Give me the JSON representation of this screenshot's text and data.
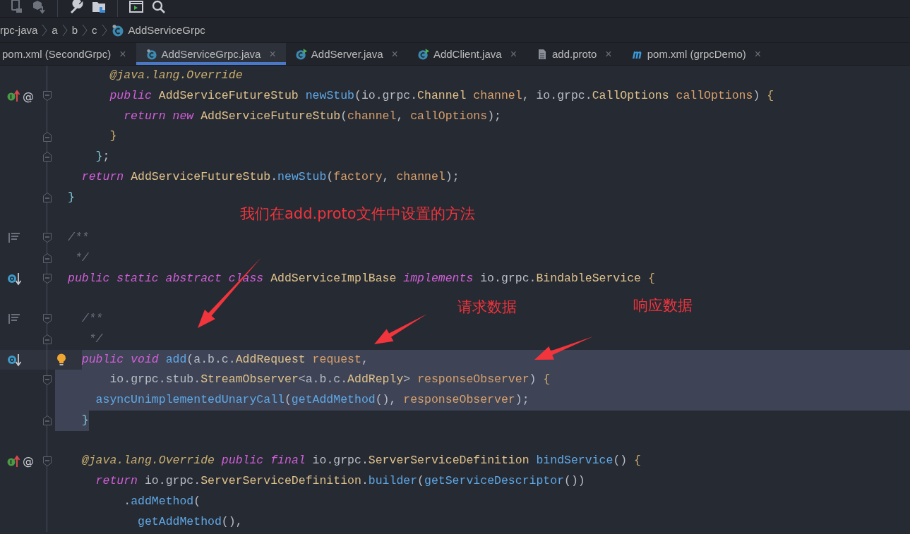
{
  "toolbar": [
    {
      "kind": "device"
    },
    {
      "kind": "cube"
    },
    {
      "kind": "separator"
    },
    {
      "kind": "wrench"
    },
    {
      "kind": "folder"
    },
    {
      "kind": "separator"
    },
    {
      "kind": "terminal"
    },
    {
      "kind": "search"
    }
  ],
  "breadcrumb": [
    {
      "label": "rpc-java"
    },
    {
      "label": "a"
    },
    {
      "label": "b"
    },
    {
      "label": "c"
    },
    {
      "label": "AddServiceGrpc",
      "kind": "class"
    }
  ],
  "tabs": [
    {
      "label": "pom.xml (SecondGrpc)",
      "kind": "none",
      "selected": false,
      "close": "×"
    },
    {
      "label": "AddServiceGrpc.java",
      "kind": "class",
      "selected": true,
      "close": "×"
    },
    {
      "label": "AddServer.java",
      "kind": "runnable",
      "selected": false,
      "close": "×"
    },
    {
      "label": "AddClient.java",
      "kind": "runnable",
      "selected": false,
      "close": "×"
    },
    {
      "label": "add.proto",
      "kind": "file",
      "selected": false,
      "close": "×"
    },
    {
      "label": "pom.xml (grpcDemo)",
      "kind": "maven",
      "selected": false,
      "close": "×"
    }
  ],
  "editor": {
    "lines": [
      {
        "kind": "code",
        "t": [
          {
            "kind": "anno",
            "text": "      @java.lang.Override"
          }
        ]
      },
      {
        "kind": "code",
        "gutter": {
          "kind": "override",
          "mark": "@"
        },
        "fold": {
          "kind": "start"
        },
        "t": [
          {
            "kind": "kw",
            "text": "      public "
          },
          {
            "kind": "type",
            "text": "AddServiceFutureStub "
          },
          {
            "kind": "fn",
            "text": "newStub"
          },
          {
            "kind": "p",
            "text": "(io.grpc."
          },
          {
            "kind": "type",
            "text": "Channel "
          },
          {
            "kind": "param",
            "text": "channel"
          },
          {
            "kind": "p",
            "text": ", io.grpc."
          },
          {
            "kind": "type",
            "text": "CallOptions "
          },
          {
            "kind": "param",
            "text": "callOptions"
          },
          {
            "kind": "p",
            "text": ") "
          },
          {
            "kind": "brace",
            "text": "{"
          }
        ]
      },
      {
        "kind": "code",
        "t": [
          {
            "kind": "kw",
            "text": "        return new "
          },
          {
            "kind": "type",
            "text": "AddServiceFutureStub"
          },
          {
            "kind": "p",
            "text": "("
          },
          {
            "kind": "param",
            "text": "channel"
          },
          {
            "kind": "p",
            "text": ", "
          },
          {
            "kind": "param",
            "text": "callOptions"
          },
          {
            "kind": "p",
            "text": ");"
          }
        ]
      },
      {
        "kind": "code",
        "fold": {
          "kind": "end"
        },
        "t": [
          {
            "kind": "brace",
            "text": "      }"
          }
        ]
      },
      {
        "kind": "code",
        "fold": {
          "kind": "end"
        },
        "t": [
          {
            "kind": "brace2",
            "text": "    }"
          },
          {
            "kind": "p",
            "text": ";"
          }
        ]
      },
      {
        "kind": "code",
        "t": [
          {
            "kind": "kw",
            "text": "  return "
          },
          {
            "kind": "type",
            "text": "AddServiceFutureStub"
          },
          {
            "kind": "p",
            "text": "."
          },
          {
            "kind": "fn",
            "text": "newStub"
          },
          {
            "kind": "p",
            "text": "("
          },
          {
            "kind": "param",
            "text": "factory"
          },
          {
            "kind": "p",
            "text": ", "
          },
          {
            "kind": "param",
            "text": "channel"
          },
          {
            "kind": "p",
            "text": ");"
          }
        ]
      },
      {
        "kind": "code",
        "fold": {
          "kind": "end"
        },
        "t": [
          {
            "kind": "brace2",
            "text": "}"
          }
        ]
      },
      {
        "kind": "blank"
      },
      {
        "kind": "code",
        "gutter": {
          "kind": "doc"
        },
        "fold": {
          "kind": "start"
        },
        "t": [
          {
            "kind": "comment",
            "text": "/**"
          }
        ]
      },
      {
        "kind": "code",
        "fold": {
          "kind": "end"
        },
        "t": [
          {
            "kind": "comment",
            "text": " */"
          }
        ]
      },
      {
        "kind": "code",
        "gutter": {
          "kind": "implemented"
        },
        "fold": {
          "kind": "start"
        },
        "t": [
          {
            "kind": "kw",
            "text": "public static abstract class "
          },
          {
            "kind": "type",
            "text": "AddServiceImplBase "
          },
          {
            "kind": "kw",
            "text": "implements "
          },
          {
            "kind": "p",
            "text": "io.grpc."
          },
          {
            "kind": "type",
            "text": "BindableService "
          },
          {
            "kind": "brace",
            "text": "{"
          }
        ]
      },
      {
        "kind": "blank"
      },
      {
        "kind": "code",
        "gutter": {
          "kind": "doc"
        },
        "fold": {
          "kind": "start"
        },
        "t": [
          {
            "kind": "comment",
            "text": "  /**"
          }
        ]
      },
      {
        "kind": "code",
        "fold": {
          "kind": "end"
        },
        "t": [
          {
            "kind": "comment",
            "text": "   */"
          }
        ]
      },
      {
        "kind": "code",
        "gutter": {
          "kind": "implemented"
        },
        "bulb": true,
        "current": true,
        "selection": {
          "kind": "from_text"
        },
        "t": [
          {
            "kind": "kw",
            "text": "  public void "
          },
          {
            "kind": "fn",
            "text": "add"
          },
          {
            "kind": "p",
            "text": "(a.b.c."
          },
          {
            "kind": "type",
            "text": "AddRequest "
          },
          {
            "kind": "param",
            "text": "request"
          },
          {
            "kind": "p",
            "text": ","
          }
        ]
      },
      {
        "kind": "code",
        "fold": {
          "kind": "start"
        },
        "selection": {
          "kind": "full"
        },
        "t": [
          {
            "kind": "p",
            "text": "      io.grpc.stub."
          },
          {
            "kind": "type",
            "text": "StreamObserver"
          },
          {
            "kind": "p",
            "text": "<a.b.c."
          },
          {
            "kind": "type",
            "text": "AddReply"
          },
          {
            "kind": "p",
            "text": "> "
          },
          {
            "kind": "param",
            "text": "responseObserver"
          },
          {
            "kind": "p",
            "text": ") "
          },
          {
            "kind": "brace",
            "text": "{"
          }
        ]
      },
      {
        "kind": "code",
        "selection": {
          "kind": "full"
        },
        "t": [
          {
            "kind": "fn",
            "text": "    asyncUnimplementedUnaryCall"
          },
          {
            "kind": "p",
            "text": "("
          },
          {
            "kind": "fn",
            "text": "getAddMethod"
          },
          {
            "kind": "p",
            "text": "(), "
          },
          {
            "kind": "param",
            "text": "responseObserver"
          },
          {
            "kind": "p",
            "text": ");"
          }
        ]
      },
      {
        "kind": "code",
        "fold": {
          "kind": "end"
        },
        "selection": {
          "kind": "to_text"
        },
        "t": [
          {
            "kind": "brace2",
            "text": "  }"
          }
        ]
      },
      {
        "kind": "blank"
      },
      {
        "kind": "code",
        "gutter": {
          "kind": "override",
          "mark": "@"
        },
        "fold": {
          "kind": "start"
        },
        "t": [
          {
            "kind": "anno",
            "text": "  @java.lang.Override "
          },
          {
            "kind": "kw",
            "text": "public final "
          },
          {
            "kind": "p",
            "text": "io.grpc."
          },
          {
            "kind": "type",
            "text": "ServerServiceDefinition "
          },
          {
            "kind": "fn",
            "text": "bindService"
          },
          {
            "kind": "p",
            "text": "() "
          },
          {
            "kind": "brace",
            "text": "{"
          }
        ]
      },
      {
        "kind": "code",
        "t": [
          {
            "kind": "kw",
            "text": "    return "
          },
          {
            "kind": "p",
            "text": "io.grpc."
          },
          {
            "kind": "type",
            "text": "ServerServiceDefinition"
          },
          {
            "kind": "p",
            "text": "."
          },
          {
            "kind": "fn",
            "text": "builder"
          },
          {
            "kind": "p",
            "text": "("
          },
          {
            "kind": "fn",
            "text": "getServiceDescriptor"
          },
          {
            "kind": "p",
            "text": "())"
          }
        ]
      },
      {
        "kind": "code",
        "t": [
          {
            "kind": "p",
            "text": "        ."
          },
          {
            "kind": "fn",
            "text": "addMethod"
          },
          {
            "kind": "p",
            "text": "("
          }
        ]
      },
      {
        "kind": "code",
        "t": [
          {
            "kind": "fn",
            "text": "          getAddMethod"
          },
          {
            "kind": "p",
            "text": "(),"
          }
        ]
      }
    ]
  },
  "notes": [
    {
      "text": "我们在add.proto文件中设置的方法"
    },
    {
      "text": "请求数据"
    },
    {
      "text": "响应数据"
    }
  ]
}
